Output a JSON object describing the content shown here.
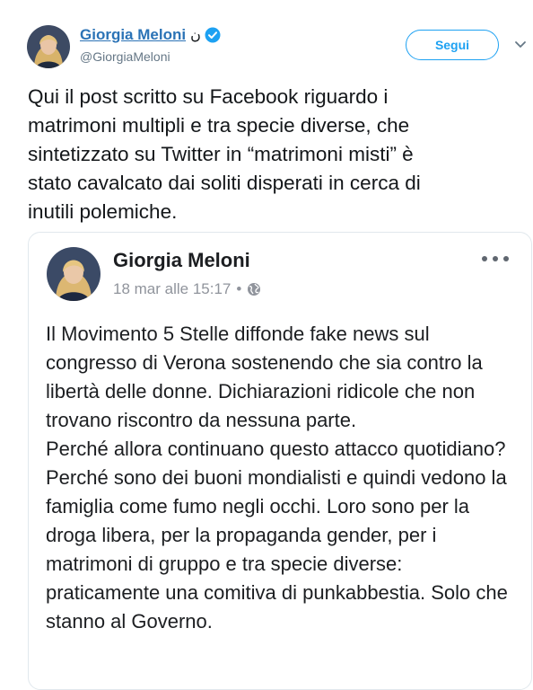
{
  "tweet": {
    "author": {
      "display_name": "Giorgia Meloni",
      "name_glyph": "ن",
      "handle": "@GiorgiaMeloni",
      "verified_icon": "verified-badge-icon"
    },
    "follow_label": "Segui",
    "menu_icon": "chevron-down-icon",
    "text": "Qui il post scritto su Facebook riguardo i\nmatrimoni multipli e tra specie diverse, che\nsintetizzato su Twitter in “matrimoni misti” è\nstato cavalcato dai soliti disperati in cerca di\ninutili polemiche."
  },
  "embedded_post": {
    "author_name": "Giorgia Meloni",
    "timestamp": "18 mar alle 15:17",
    "separator": "•",
    "privacy_icon": "globe-icon",
    "more_icon": "more-options-icon",
    "paragraphs": [
      "Il Movimento 5 Stelle diffonde fake news sul congresso di Verona sostenendo che sia contro la libertà delle donne. Dichiarazioni ridicole che non trovano riscontro da nessuna parte.",
      "Perché allora continuano questo attacco quotidiano? Perché sono dei buoni mondialisti e quindi vedono la famiglia come fumo negli occhi. Loro sono per la droga libera, per la propaganda gender, per i matrimoni di gruppo e tra specie diverse: praticamente una comitiva di punkabbestia. Solo che stanno al Governo."
    ]
  },
  "colors": {
    "link_blue": "#2b73b6",
    "follow_blue": "#1da1f2",
    "secondary_gray": "#657786",
    "card_border": "#e1e8ed"
  }
}
